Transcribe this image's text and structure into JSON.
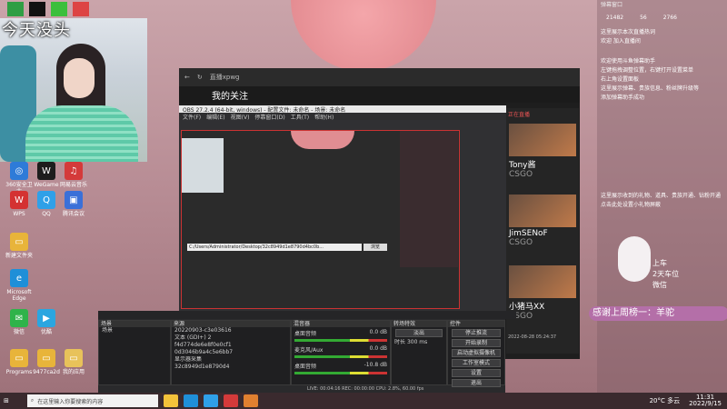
{
  "overlay_title": "今天没头",
  "desktop_icons": [
    {
      "label": "360安全卫士",
      "color": "#2e7bd8",
      "glyph": "◎"
    },
    {
      "label": "WeGame",
      "color": "#1d1d1d",
      "glyph": "W"
    },
    {
      "label": "网易云音乐",
      "color": "#d43a3a",
      "glyph": "♫"
    },
    {
      "label": "WPS",
      "color": "#d43232",
      "glyph": "W"
    },
    {
      "label": "QQ",
      "color": "#2fa0e8",
      "glyph": "Q"
    },
    {
      "label": "腾讯会议",
      "color": "#3a70d8",
      "glyph": "▣"
    },
    {
      "label": "新建文件夹",
      "color": "#e8b43a",
      "glyph": "▭"
    },
    {
      "label": "Microsoft Edge",
      "color": "#1f8fd8",
      "glyph": "e"
    },
    {
      "label": "微信",
      "color": "#2fb34a",
      "glyph": "✉"
    },
    {
      "label": "优酷",
      "color": "#2aa6e0",
      "glyph": "▶"
    },
    {
      "label": "Programs",
      "color": "#e8b43a",
      "glyph": "▭"
    },
    {
      "label": "9477ca2d",
      "color": "#e8b43a",
      "glyph": "▭"
    },
    {
      "label": "我的应用",
      "color": "#e8c25a",
      "glyph": "▭"
    }
  ],
  "browser": {
    "title": "直播xpwg",
    "nav_title": "我的关注",
    "items": [
      {
        "name": "Tony酱",
        "time": "CSGO"
      },
      {
        "name": "JimSENoF",
        "time": "CSGO"
      },
      {
        "name": "小猪马XX",
        "time": "CSGO"
      }
    ],
    "date_label": "2022-08-28 05:24:37",
    "status_label": "正在直播"
  },
  "obs_window": {
    "title": "OBS 27.2.4 (64-bit, windows) - 配置文件: 未命名 - 场景: 未命名",
    "menus": [
      "文件(F)",
      "编辑(E)",
      "视图(V)",
      "停靠窗口(D)",
      "工具(T)",
      "帮助(H)"
    ],
    "path": "C:/Users/Administrator/Desktop/32c8949d1e8790d4bc0b...",
    "browse_label": "浏览"
  },
  "dock": {
    "scenes_header": "场景",
    "scenes": [
      "场景"
    ],
    "sources_header": "来源",
    "sources": [
      "20220903-c3e03616",
      "文本 (GDI+) 2",
      "f4d774de6e8f0e0cf1",
      "0d3046b9a4c5e6bb7",
      "显示器采集",
      "32c8949d1e8790d4"
    ],
    "mixer_header": "混音器",
    "mixer": [
      {
        "name": "桌面音频",
        "level": "0.0 dB"
      },
      {
        "name": "麦克风/Aux",
        "level": "0.0 dB"
      },
      {
        "name": "桌面音频",
        "level": "-10.8 dB"
      }
    ],
    "transition_header": "转场特效",
    "transition_value": "淡出",
    "duration_label": "时长",
    "duration_value": "300 ms",
    "controls_header": "控件",
    "controls": [
      "停止推流",
      "开始录制",
      "启动虚拟摄像机",
      "工作室模式",
      "设置",
      "退出"
    ],
    "status": "LIVE: 00:04:16   REC: 00:00:00   CPU: 2.8%, 60.00 fps"
  },
  "chat": {
    "header": "弹幕窗口",
    "stats": [
      "21482",
      "56",
      "2766"
    ],
    "messages": [
      "这里展示本次直播热词",
      "欢迎 加入直播间",
      "欢迎使用斗鱼弹幕助手",
      "左键拖拽调整位置，右键打开设置菜单",
      "右上角设置面板",
      "这里展示弹幕、贵族信息、粉丝牌升级等",
      "添加弹幕助手成功",
      "这里展示收到的礼物、道具、贵族开通、钻粉开通",
      "点击此处设置小礼物屏蔽"
    ],
    "badge_lines": [
      "上车",
      "2天车位",
      "微信"
    ],
    "banner": "感谢上周榜一：羊驼"
  },
  "taskbar": {
    "search_placeholder": "在这里输入你要搜索的内容",
    "weather": "20°C 多云",
    "time": "11:31",
    "date": "2022/9/15"
  },
  "colors": {
    "obs_border": "#cc3333",
    "live_green": "#2fb34a"
  }
}
